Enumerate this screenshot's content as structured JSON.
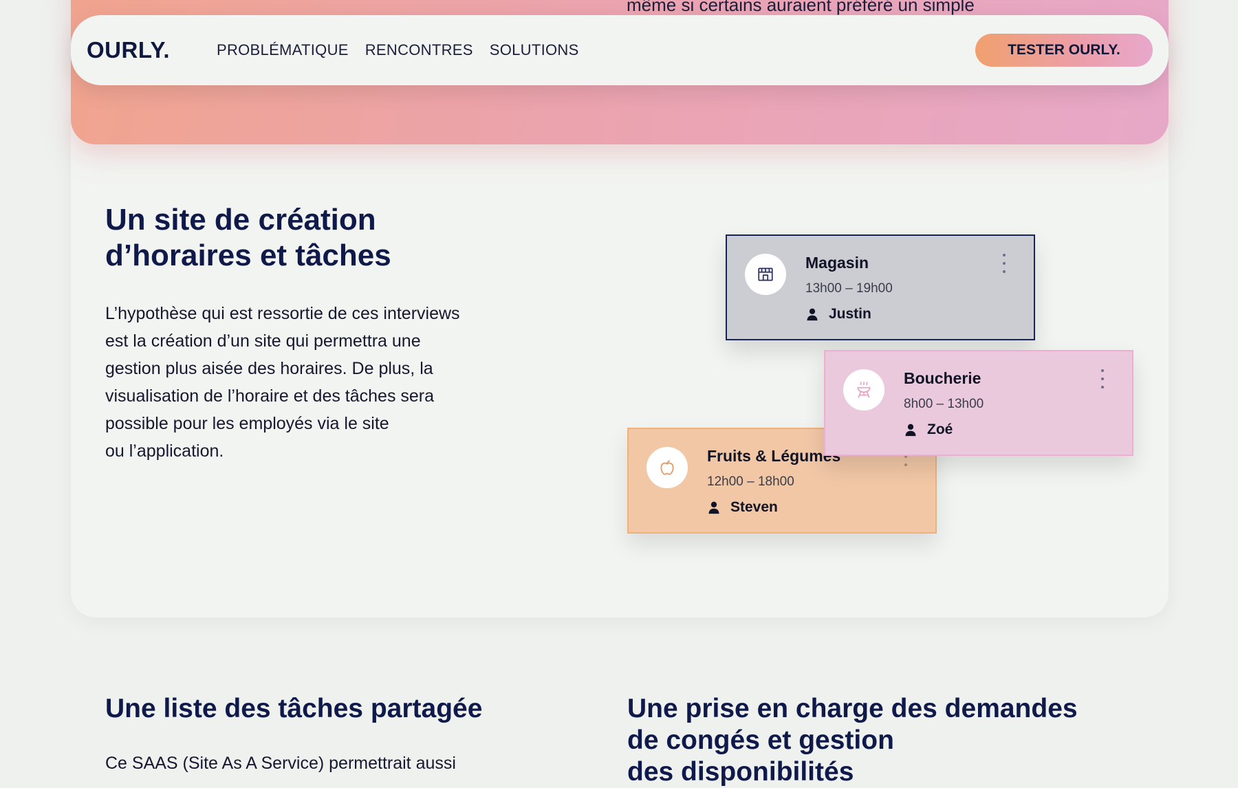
{
  "hero": {
    "partial_text": "même si certains auraient préféré un simple"
  },
  "nav": {
    "logo": "OURLY.",
    "links": [
      "PROBLÉMATIQUE",
      "RENCONTRES",
      "SOLUTIONS"
    ],
    "cta": "TESTER OURLY."
  },
  "feature": {
    "title_lines": [
      "Un site de création",
      "d’horaires et tâches"
    ],
    "body_lines": [
      "L’hypothèse qui est ressortie de ces interviews",
      "est la création d’un site qui permettra une",
      "gestion plus aisée des horaires. De plus, la",
      "visualisation de l’horaire et des tâches sera",
      "possible pour les employés via le site",
      "ou l’application."
    ]
  },
  "tasks": [
    {
      "name": "Magasin",
      "time": "13h00 – 19h00",
      "person": "Justin",
      "icon": "store-icon",
      "color": "#cbcdd2"
    },
    {
      "name": "Boucherie",
      "time": "8h00 – 13h00",
      "person": "Zoé",
      "icon": "grill-icon",
      "color": "#ebc9dc"
    },
    {
      "name": "Fruits & Légumes",
      "time": "12h00 – 18h00",
      "person": "Steven",
      "icon": "apple-icon",
      "color": "#f1c7a6"
    }
  ],
  "bottom": {
    "left_title": "Une liste des tâches partagée",
    "left_body": "Ce SAAS (Site As A Service) permettrait aussi",
    "right_title_lines": [
      "Une prise en charge des demandes",
      "de congés et gestion",
      "des disponibilités"
    ]
  },
  "colors": {
    "accent_navy": "#0f1a4a",
    "cta_start": "#f0a06e",
    "cta_end": "#e8a8cc"
  }
}
